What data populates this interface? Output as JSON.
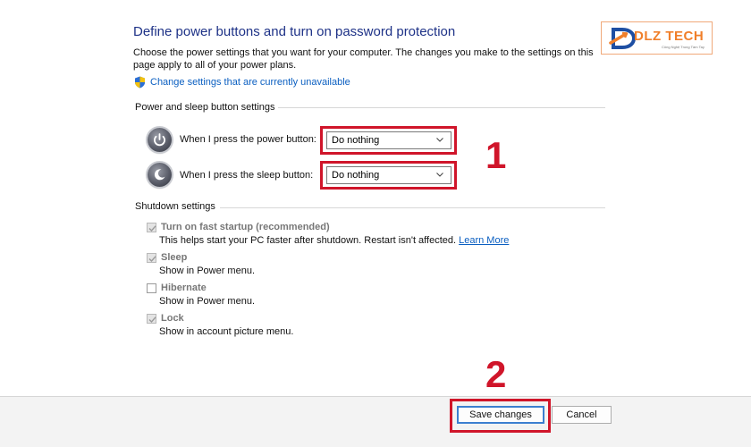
{
  "header": {
    "title": "Define power buttons and turn on password protection",
    "intro": "Choose the power settings that you want for your computer. The changes you make to the settings on this page apply to all of your power plans.",
    "change_link": "Change settings that are currently unavailable"
  },
  "power_section": {
    "heading": "Power and sleep button settings",
    "rows": [
      {
        "label": "When I press the power button:",
        "value": "Do nothing",
        "icon": "power-button-icon"
      },
      {
        "label": "When I press the sleep button:",
        "value": "Do nothing",
        "icon": "sleep-button-icon"
      }
    ]
  },
  "shutdown_section": {
    "heading": "Shutdown settings",
    "items": [
      {
        "label": "Turn on fast startup (recommended)",
        "description": "This helps start your PC faster after shutdown. Restart isn't affected.",
        "link": "Learn More",
        "checked": true
      },
      {
        "label": "Sleep",
        "description": "Show in Power menu.",
        "checked": true
      },
      {
        "label": "Hibernate",
        "description": "Show in Power menu.",
        "checked": false
      },
      {
        "label": "Lock",
        "description": "Show in account picture menu.",
        "checked": true
      }
    ]
  },
  "footer": {
    "save_label": "Save changes",
    "cancel_label": "Cancel"
  },
  "annotations": {
    "step1": "1",
    "step2": "2",
    "highlight_color": "#d0152a"
  },
  "watermark": {
    "brand": "DLZ TECH",
    "tagline": "Công Nghệ Trong Tầm Tay"
  }
}
